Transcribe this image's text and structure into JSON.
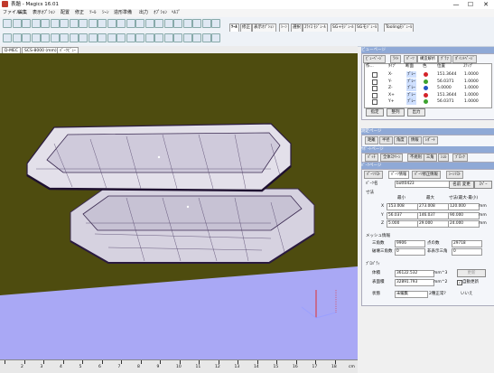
{
  "window": {
    "title": "表題 - Magics 16.01",
    "minimize": "—",
    "maximize": "☐",
    "close": "✕"
  },
  "menu": [
    "ファイル",
    "編集",
    "表示ｵﾌﾟｼｮﾝ",
    "配置",
    "修正",
    "ﾂｰﾙ",
    "ｼｰﾝ",
    "造形準備",
    "出力",
    "ｵﾌﾟｼｮﾝ",
    "ﾍﾙﾌﾟ"
  ],
  "ribbon_tabs": [
    "ﾂｰﾙ",
    "修正",
    "表示ｵﾌﾟｼｮﾝ",
    "ｼｰﾝ",
    "選択",
    "ｽﾗｲｽ ﾓｼﾞｭｰﾙ",
    "SG+ﾓｼﾞｭｰﾙ",
    "SGモｼﾞｭｰﾙ",
    "Toolingﾓｼﾞｭｰﾙ"
  ],
  "view_tabs": [
    "D-MEC",
    "SCS-8000 (mm)",
    "ﾊﾟｰﾂﾋﾞｭｰ"
  ],
  "ruler": {
    "numbers": [
      "2",
      "3",
      "4",
      "5",
      "6",
      "7",
      "8",
      "9",
      "10",
      "11",
      "12",
      "13",
      "14",
      "15",
      "16",
      "17",
      "18"
    ],
    "unit": "cm"
  },
  "view_panel": {
    "title": "ビューページ",
    "tabs": [
      "ﾋﾞｭｰﾍﾟｰｼﾞ",
      "ﾗｲﾄ",
      "ﾊﾟｰﾂ",
      "構造解析",
      "ｸﾞﾗﾌ",
      "ﾎﾟｲﾝﾄﾍﾟｰｼﾞ"
    ],
    "columns": [
      "作...",
      "ﾀｲﾌﾟ",
      "断面",
      "色",
      "位置",
      "ｽﾃｯﾌﾟ"
    ],
    "rows": [
      {
        "type": "X-",
        "section": "ﾌﾟﾚｰ",
        "color": "#d4242a",
        "pos": "151.3644",
        "step": "1.0000"
      },
      {
        "type": "Y-",
        "section": "ﾌﾟﾚｰ",
        "color": "#3ca32f",
        "pos": "56.0371",
        "step": "1.0000"
      },
      {
        "type": "Z-",
        "section": "ﾌﾟﾚｰ",
        "color": "#2457c5",
        "pos": "5.0000",
        "step": "1.0000"
      },
      {
        "type": "X+",
        "section": "ﾌﾟﾚｰ",
        "color": "#d4242a",
        "pos": "151.3644",
        "step": "1.0000"
      },
      {
        "type": "Y+",
        "section": "ﾌﾟﾚｰ",
        "color": "#3ca32f",
        "pos": "56.0371",
        "step": "1.0000"
      }
    ],
    "buttons": [
      "指定",
      "整列",
      "出力"
    ]
  },
  "measure_panel": {
    "title": "測定ページ",
    "tabs": [
      "距離",
      "半径",
      "角度",
      "情報",
      "ﾚﾎﾟｰﾄ"
    ]
  },
  "support_panel": {
    "title": "ｻﾎﾟｰﾄページ",
    "tabs": [
      "ﾊﾟｯﾁ",
      "全体ｽｸﾘｰﾝ",
      "不規則",
      "三角",
      "ｼｪﾙ",
      "ﾌﾞﾛｯｸ"
    ]
  },
  "part_panel": {
    "title": "ﾊﾟｰﾂページ",
    "tabs": [
      "ﾊﾟｰﾂﾘｽﾄ",
      "ﾊﾟｰﾂ情報",
      "ﾊﾟｰﾂ修正情報",
      "ｼｰﾝﾘｽﾄ"
    ],
    "name_label": "ﾊﾟｰﾂ名",
    "name_value": "bott0423",
    "rename_button": "名前 変更",
    "more_button": "ｽﾍﾟｰ",
    "dims_label": "寸法",
    "col_min": "最小",
    "col_max": "最大",
    "col_size": "寸法(最大-最小)",
    "axes": [
      "X",
      "Y",
      "Z"
    ],
    "x": [
      "153.008",
      "273.008",
      "120.000"
    ],
    "y": [
      "56.037",
      "146.037",
      "90.000"
    ],
    "z": [
      "5.000",
      "29.000",
      "24.000"
    ],
    "unit_mm": "mm",
    "mesh_label": "メッシュ情報",
    "triangles_label": "三角数",
    "triangles_value": "9906",
    "points_label": "点の数",
    "points_value": "29718",
    "bad_label": "破壊三角数",
    "bad_value": "0",
    "shells_label": "非表示三角",
    "shells_value": "0",
    "volume_section": "ﾌﾟﾛﾊﾟﾃｨ",
    "volume_label": "体積",
    "volume_value": "36122.532",
    "volume_unit": "mm^3",
    "area_label": "表面積",
    "area_value": "32891.793",
    "area_unit": "mm^2",
    "update_button": "更新",
    "auto_update_label": "自動更新",
    "status_label": "状態",
    "status_value": "未編集",
    "repair_label": "2種正常?",
    "repair_value": "いいえ"
  }
}
